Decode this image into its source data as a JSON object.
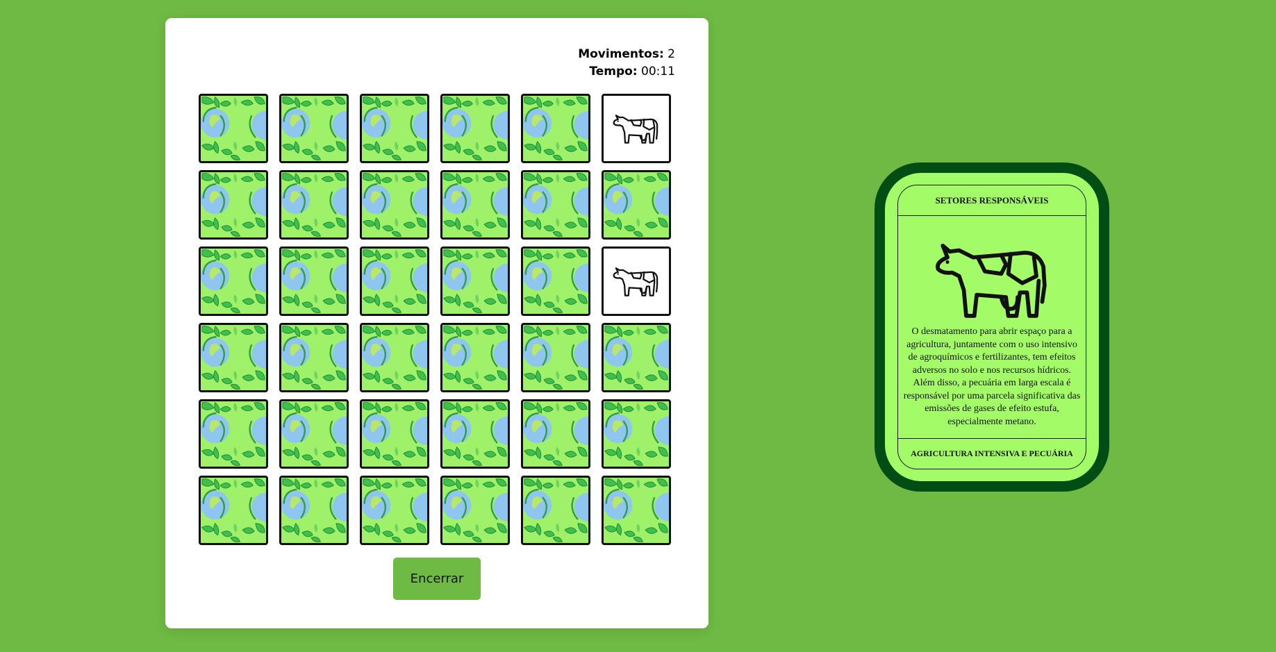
{
  "stats": {
    "moves_label": "Movimentos:",
    "moves_value": "2",
    "time_label": "Tempo:",
    "time_value": "00:11"
  },
  "board": {
    "columns": 6,
    "rows": 6,
    "cards": [
      {
        "state": "hidden"
      },
      {
        "state": "hidden"
      },
      {
        "state": "hidden"
      },
      {
        "state": "hidden"
      },
      {
        "state": "hidden"
      },
      {
        "state": "flipped",
        "icon": "cow-icon"
      },
      {
        "state": "hidden"
      },
      {
        "state": "hidden"
      },
      {
        "state": "hidden"
      },
      {
        "state": "hidden"
      },
      {
        "state": "hidden"
      },
      {
        "state": "hidden"
      },
      {
        "state": "hidden"
      },
      {
        "state": "hidden"
      },
      {
        "state": "hidden"
      },
      {
        "state": "hidden"
      },
      {
        "state": "hidden"
      },
      {
        "state": "flipped",
        "icon": "cow-icon"
      },
      {
        "state": "hidden"
      },
      {
        "state": "hidden"
      },
      {
        "state": "hidden"
      },
      {
        "state": "hidden"
      },
      {
        "state": "hidden"
      },
      {
        "state": "hidden"
      },
      {
        "state": "hidden"
      },
      {
        "state": "hidden"
      },
      {
        "state": "hidden"
      },
      {
        "state": "hidden"
      },
      {
        "state": "hidden"
      },
      {
        "state": "hidden"
      },
      {
        "state": "hidden"
      },
      {
        "state": "hidden"
      },
      {
        "state": "hidden"
      },
      {
        "state": "hidden"
      },
      {
        "state": "hidden"
      },
      {
        "state": "hidden"
      }
    ],
    "card_back_icon": "earth-leaves-pattern-icon"
  },
  "end_button": {
    "label": "Encerrar"
  },
  "info_card": {
    "title": "SETORES RESPONSÁVEIS",
    "icon": "cow-icon",
    "description": "O desmatamento para abrir espaço para a agricultura, juntamente com o uso intensivo de agroquímicos e fertilizantes, tem efeitos adversos no solo e nos recursos hídricos. Além disso, a pecuária em larga escala é responsável por uma parcela significativa das emissões de gases de efeito estufa, especialmente metano.",
    "footer": "AGRICULTURA INTENSIVA E PECUÁRIA"
  },
  "colors": {
    "page_background": "#6fba44",
    "card_back": "#9ff16a",
    "info_card_border": "#024d13",
    "info_card_fill": "#a3fb67",
    "button": "#6fba44"
  }
}
